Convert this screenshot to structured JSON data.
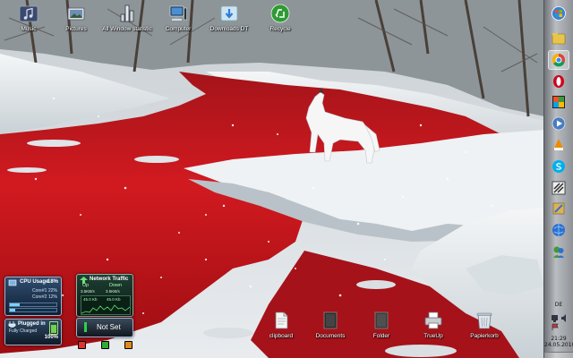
{
  "desktop": {
    "top_icons": [
      {
        "label": "Music",
        "icon": "music-folder-icon"
      },
      {
        "label": "Pictures",
        "icon": "pictures-folder-icon"
      },
      {
        "label": "All Window statistic",
        "icon": "statistics-icon"
      },
      {
        "label": "Computer",
        "icon": "computer-icon"
      },
      {
        "label": "Downloads DT",
        "icon": "downloads-folder-icon"
      },
      {
        "label": "Recycle",
        "icon": "recycle-icon"
      }
    ],
    "bottom_icons": [
      {
        "label": "clipboard",
        "icon": "text-document-icon"
      },
      {
        "label": "Documents",
        "icon": "documents-folder-icon"
      },
      {
        "label": "Folder",
        "icon": "folder-icon"
      },
      {
        "label": "TrueUp",
        "icon": "printer-icon"
      },
      {
        "label": "Papierkorb",
        "icon": "recycle-bin-icon"
      }
    ]
  },
  "gadgets": {
    "cpu": {
      "title": "CPU Usage",
      "total": "18%",
      "cores": [
        {
          "label": "Core#1",
          "value": "22%",
          "level": 0.22
        },
        {
          "label": "Core#2",
          "value": "12%",
          "level": 0.12
        }
      ]
    },
    "network": {
      "title": "Network Traffic",
      "up_label": "Up",
      "down_label": "Down",
      "up_speed": "3.5KB/s",
      "down_speed": "3.5KB/s",
      "up_total": "45.0 Kb",
      "down_total": "45.0 Kb"
    },
    "battery": {
      "status": "Plugged in",
      "detail": "Fully Charged",
      "percent": "100%",
      "level": 1.0
    },
    "status": {
      "label": "Not Set"
    }
  },
  "taskbar": {
    "pinned": [
      {
        "name": "start-orb",
        "color": "#3b7fd6"
      },
      {
        "name": "explorer",
        "color": "#e8c54a"
      },
      {
        "name": "chrome",
        "color": "#db4437"
      },
      {
        "name": "opera",
        "color": "#d0021b"
      },
      {
        "name": "windows-live",
        "color": "#3a9b3a"
      },
      {
        "name": "media-player",
        "color": "#4a7dbf"
      },
      {
        "name": "vlc",
        "color": "#f08a00"
      },
      {
        "name": "skype",
        "color": "#00aff0"
      },
      {
        "name": "tool",
        "color": "#2b2b2b"
      },
      {
        "name": "paint",
        "color": "#d9b25a"
      },
      {
        "name": "browser",
        "color": "#2f6fcf"
      },
      {
        "name": "messenger",
        "color": "#3f9c35"
      }
    ],
    "language": "DE",
    "time": "21:29",
    "date": "24.05.2010"
  }
}
